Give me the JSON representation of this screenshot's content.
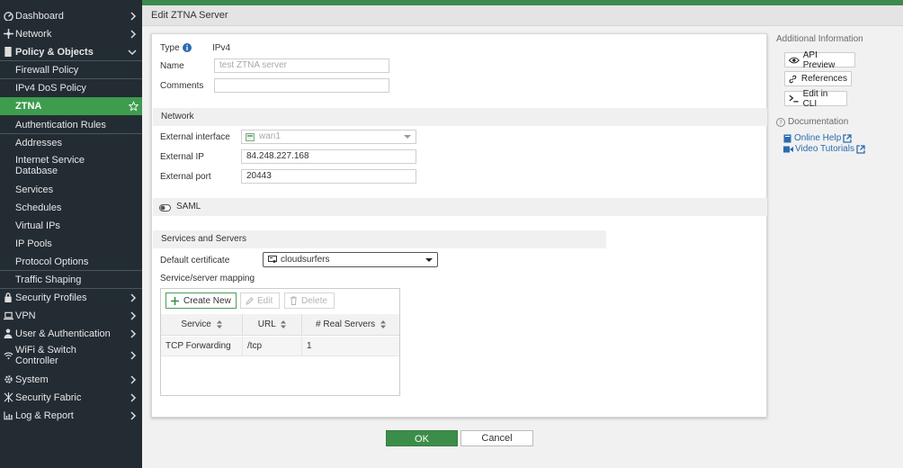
{
  "header": {
    "title": "Edit ZTNA Server"
  },
  "sidebar": {
    "items": [
      {
        "label": "Dashboard"
      },
      {
        "label": "Network"
      },
      {
        "label": "Policy & Objects"
      },
      {
        "label": "Firewall Policy"
      },
      {
        "label": "IPv4 DoS Policy"
      },
      {
        "label": "ZTNA"
      },
      {
        "label": "Authentication Rules"
      },
      {
        "label": "Addresses"
      },
      {
        "label": "Internet Service",
        "label2": "Database"
      },
      {
        "label": "Services"
      },
      {
        "label": "Schedules"
      },
      {
        "label": "Virtual IPs"
      },
      {
        "label": "IP Pools"
      },
      {
        "label": "Protocol Options"
      },
      {
        "label": "Traffic Shaping"
      },
      {
        "label": "Security Profiles"
      },
      {
        "label": "VPN"
      },
      {
        "label": "User & Authentication"
      },
      {
        "label": "WiFi & Switch",
        "label2": "Controller"
      },
      {
        "label": "System"
      },
      {
        "label": "Security Fabric"
      },
      {
        "label": "Log & Report"
      }
    ]
  },
  "form": {
    "type_label": "Type",
    "type_value": "IPv4",
    "name_label": "Name",
    "name_value": "test ZTNA server",
    "comments_label": "Comments",
    "comments_value": "",
    "network_section": "Network",
    "external_interface_label": "External interface",
    "external_interface_value": "wan1",
    "external_ip_label": "External IP",
    "external_ip_value": "84.248.227.168",
    "external_port_label": "External port",
    "external_port_value": "20443",
    "saml_label": "SAML",
    "services_section": "Services and Servers",
    "default_cert_label": "Default certificate",
    "default_cert_value": "cloudsurfers",
    "mapping_label": "Service/server mapping"
  },
  "mapping_toolbar": {
    "create_new": "Create New",
    "edit": "Edit",
    "delete": "Delete"
  },
  "mapping_table": {
    "columns": [
      "Service",
      "URL",
      "# Real Servers"
    ],
    "rows": [
      {
        "service": "TCP Forwarding",
        "url": "/tcp",
        "real_servers": "1"
      }
    ]
  },
  "right_panel": {
    "additional_info": "Additional Information",
    "api_preview": "API Preview",
    "references": "References",
    "edit_in_cli": "Edit in CLI",
    "documentation": "Documentation",
    "online_help": "Online Help",
    "video_tutorials": "Video Tutorials"
  },
  "footer": {
    "ok": "OK",
    "cancel": "Cancel"
  },
  "colors": {
    "accent": "#3d9c4e",
    "sidebar_bg": "#232c33",
    "link": "#2a6cb0"
  }
}
